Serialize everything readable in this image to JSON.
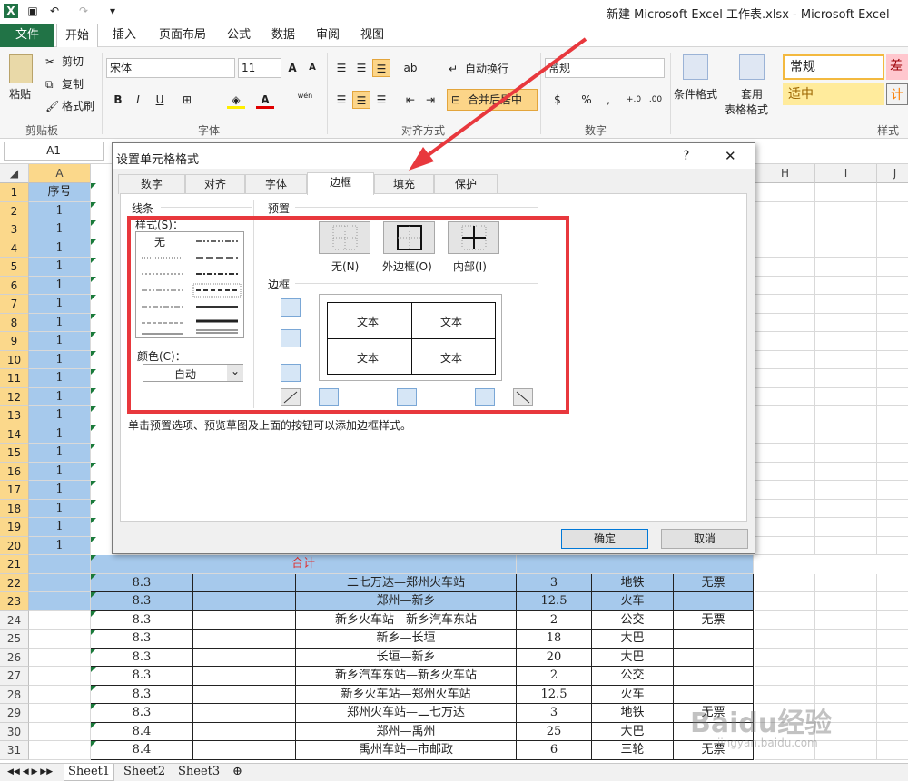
{
  "window": {
    "title": "新建 Microsoft Excel 工作表.xlsx - Microsoft Excel"
  },
  "ribbon": {
    "tabs": [
      "文件",
      "开始",
      "插入",
      "页面布局",
      "公式",
      "数据",
      "审阅",
      "视图"
    ],
    "clipboard": {
      "paste": "粘贴",
      "cut": "剪切",
      "copy": "复制",
      "format_painter": "格式刷",
      "label": "剪贴板"
    },
    "font": {
      "name": "宋体",
      "size": "11",
      "bold": "B",
      "italic": "I",
      "underline": "U",
      "label": "字体",
      "wen": "wén"
    },
    "align": {
      "wrap": "自动换行",
      "merge": "合并后居中",
      "label": "对齐方式"
    },
    "number": {
      "format": "常规",
      "label": "数字"
    },
    "styles": {
      "cond": "条件格式",
      "table_a": "套用",
      "table_b": "表格格式",
      "normal": "常规",
      "bad": "差",
      "good": "适中",
      "calc": "计",
      "label": "样式"
    }
  },
  "formula_bar": {
    "name_box": "A1"
  },
  "grid": {
    "columns": [
      "A",
      "H",
      "I",
      "J"
    ],
    "row_numbers": [
      "1",
      "2",
      "3",
      "4",
      "5",
      "6",
      "7",
      "8",
      "9",
      "10",
      "11",
      "12",
      "13",
      "14",
      "15",
      "16",
      "17",
      "18",
      "19",
      "20",
      "21",
      "22",
      "23",
      "24",
      "25",
      "26",
      "27",
      "28",
      "29",
      "30",
      "31"
    ],
    "a_header": "序号",
    "a_values": [
      "1",
      "1",
      "1",
      "1",
      "1",
      "1",
      "1",
      "1",
      "1",
      "1",
      "1",
      "1",
      "1",
      "1",
      "1",
      "1",
      "1",
      "1",
      "1"
    ],
    "total_label": "合计",
    "rows": [
      {
        "r": "22",
        "b": "8.3",
        "d": "二七万达—郑州火车站",
        "e": "3",
        "f": "地铁",
        "g": "无票"
      },
      {
        "r": "23",
        "b": "8.3",
        "d": "郑州—新乡",
        "e": "12.5",
        "f": "火车",
        "g": ""
      },
      {
        "r": "24",
        "b": "8.3",
        "d": "新乡火车站—新乡汽车东站",
        "e": "2",
        "f": "公交",
        "g": "无票"
      },
      {
        "r": "25",
        "b": "8.3",
        "d": "新乡—长垣",
        "e": "18",
        "f": "大巴",
        "g": ""
      },
      {
        "r": "26",
        "b": "8.3",
        "d": "长垣—新乡",
        "e": "20",
        "f": "大巴",
        "g": ""
      },
      {
        "r": "27",
        "b": "8.3",
        "d": "新乡汽车东站—新乡火车站",
        "e": "2",
        "f": "公交",
        "g": ""
      },
      {
        "r": "28",
        "b": "8.3",
        "d": "新乡火车站—郑州火车站",
        "e": "12.5",
        "f": "火车",
        "g": ""
      },
      {
        "r": "29",
        "b": "8.3",
        "d": "郑州火车站—二七万达",
        "e": "3",
        "f": "地铁",
        "g": "无票"
      },
      {
        "r": "30",
        "b": "8.4",
        "d": "郑州—禹州",
        "e": "25",
        "f": "大巴",
        "g": ""
      },
      {
        "r": "31",
        "b": "8.4",
        "d": "禹州车站—市邮政",
        "e": "6",
        "f": "三轮",
        "g": "无票"
      }
    ]
  },
  "sheets": [
    "Sheet1",
    "Sheet2",
    "Sheet3"
  ],
  "dialog": {
    "title": "设置单元格格式",
    "help": "?",
    "close": "✕",
    "tabs": [
      "数字",
      "对齐",
      "字体",
      "边框",
      "填充",
      "保护"
    ],
    "active_tab": "边框",
    "line_group": "线条",
    "style_label": "样式(S)：",
    "style_none": "无",
    "color_label": "颜色(C)：",
    "color_value": "自动",
    "preset_group": "预置",
    "presets": [
      "无(N)",
      "外边框(O)",
      "内部(I)"
    ],
    "border_group": "边框",
    "preview_text": "文本",
    "hint": "单击预置选项、预览草图及上面的按钮可以添加边框样式。",
    "ok": "确定",
    "cancel": "取消"
  },
  "watermark": {
    "text": "Baidu经验",
    "url": "jingyan.baidu.com"
  },
  "colors": {
    "excel_green": "#217346",
    "selection": "#a6c9ec",
    "red_annotation": "#e8383d",
    "total_red": "#e03030"
  }
}
